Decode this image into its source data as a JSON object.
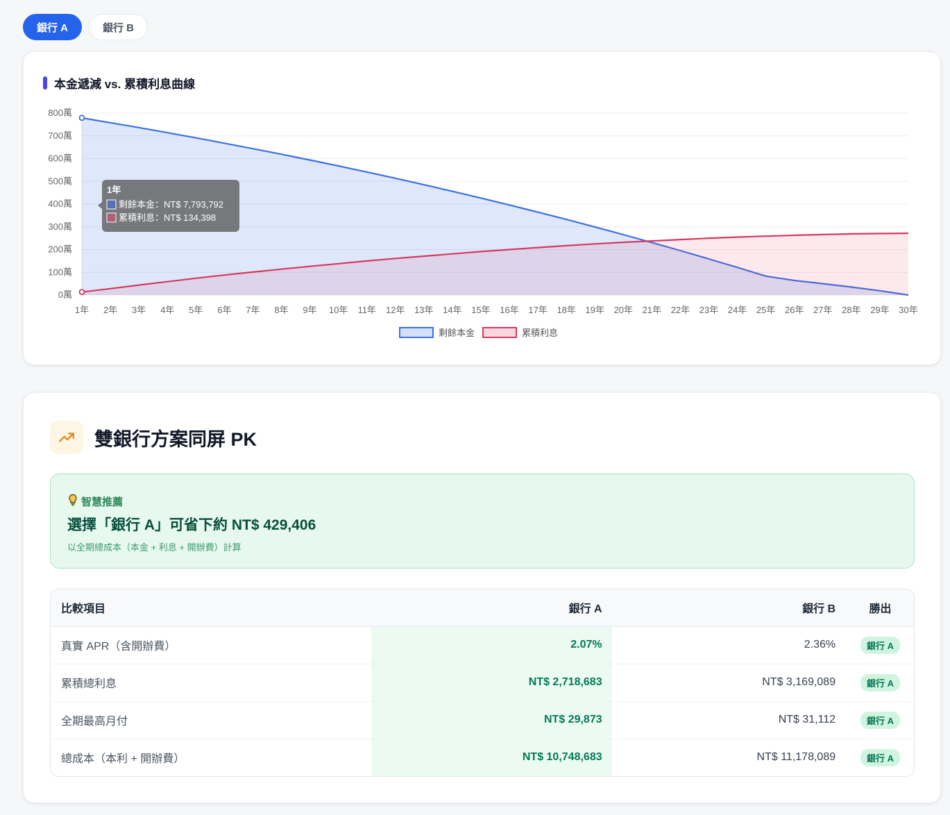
{
  "tabs": [
    {
      "label": "銀行 A",
      "active": true
    },
    {
      "label": "銀行 B",
      "active": false
    }
  ],
  "chart_card": {
    "title": "本金遞減 vs. 累積利息曲線"
  },
  "chart_data": {
    "type": "area",
    "title": "本金遞減 vs. 累積利息曲線",
    "categories": [
      "1年",
      "2年",
      "3年",
      "4年",
      "5年",
      "6年",
      "7年",
      "8年",
      "9年",
      "10年",
      "11年",
      "12年",
      "13年",
      "14年",
      "15年",
      "16年",
      "17年",
      "18年",
      "19年",
      "20年",
      "21年",
      "22年",
      "23年",
      "24年",
      "25年",
      "26年",
      "27年",
      "28年",
      "29年",
      "30年"
    ],
    "y_ticks": [
      "0萬",
      "100萬",
      "200萬",
      "300萬",
      "400萬",
      "500萬",
      "600萬",
      "700萬",
      "800萬"
    ],
    "ylim": [
      0,
      8000000
    ],
    "grid": true,
    "legend_position": "bottom",
    "series": [
      {
        "name": "剩餘本金",
        "color": "#3b6fe6",
        "fill": "rgba(59,111,230,0.16)",
        "values": [
          7793792,
          7580000,
          7365000,
          7143000,
          6913000,
          6679000,
          6438000,
          6191000,
          5938000,
          5678000,
          5410000,
          5135000,
          4853000,
          4563000,
          4265000,
          3960000,
          3647000,
          3325000,
          2995000,
          2656000,
          2309000,
          1953000,
          1589000,
          1215000,
          832000,
          640000,
          500000,
          350000,
          190000,
          0
        ]
      },
      {
        "name": "累積利息",
        "color": "#d63763",
        "fill": "rgba(226,74,106,0.12)",
        "values": [
          134398,
          280000,
          440000,
          590000,
          740000,
          880000,
          1010000,
          1140000,
          1260000,
          1380000,
          1500000,
          1610000,
          1710000,
          1810000,
          1910000,
          2000000,
          2090000,
          2170000,
          2250000,
          2320000,
          2380000,
          2440000,
          2500000,
          2550000,
          2590000,
          2630000,
          2660000,
          2690000,
          2705000,
          2718683
        ]
      }
    ],
    "tooltip": {
      "title": "1年",
      "lines": [
        "剩餘本金：NT$ 7,793,792",
        "累積利息：NT$ 134,398"
      ]
    }
  },
  "pk": {
    "title": "雙銀行方案同屏 PK",
    "icon": "trending-up-icon",
    "recommendation": {
      "label": "智慧推薦",
      "icon": "lightbulb-icon",
      "main": "選擇「銀行 A」可省下約 NT$ 429,406",
      "sub": "以全期總成本（本金 + 利息 + 開辦費）計算"
    },
    "table": {
      "headers": {
        "item": "比較項目",
        "a": "銀行 A",
        "b": "銀行 B",
        "winner": "勝出"
      },
      "rows": [
        {
          "item": "真實 APR（含開辦費）",
          "a": "2.07%",
          "b": "2.36%",
          "winner": "銀行 A"
        },
        {
          "item": "累積總利息",
          "a": "NT$ 2,718,683",
          "b": "NT$ 3,169,089",
          "winner": "銀行 A"
        },
        {
          "item": "全期最高月付",
          "a": "NT$ 29,873",
          "b": "NT$ 31,112",
          "winner": "銀行 A"
        },
        {
          "item": "總成本（本利 + 開辦費）",
          "a": "NT$ 10,748,683",
          "b": "NT$ 11,178,089",
          "winner": "銀行 A"
        }
      ]
    }
  }
}
